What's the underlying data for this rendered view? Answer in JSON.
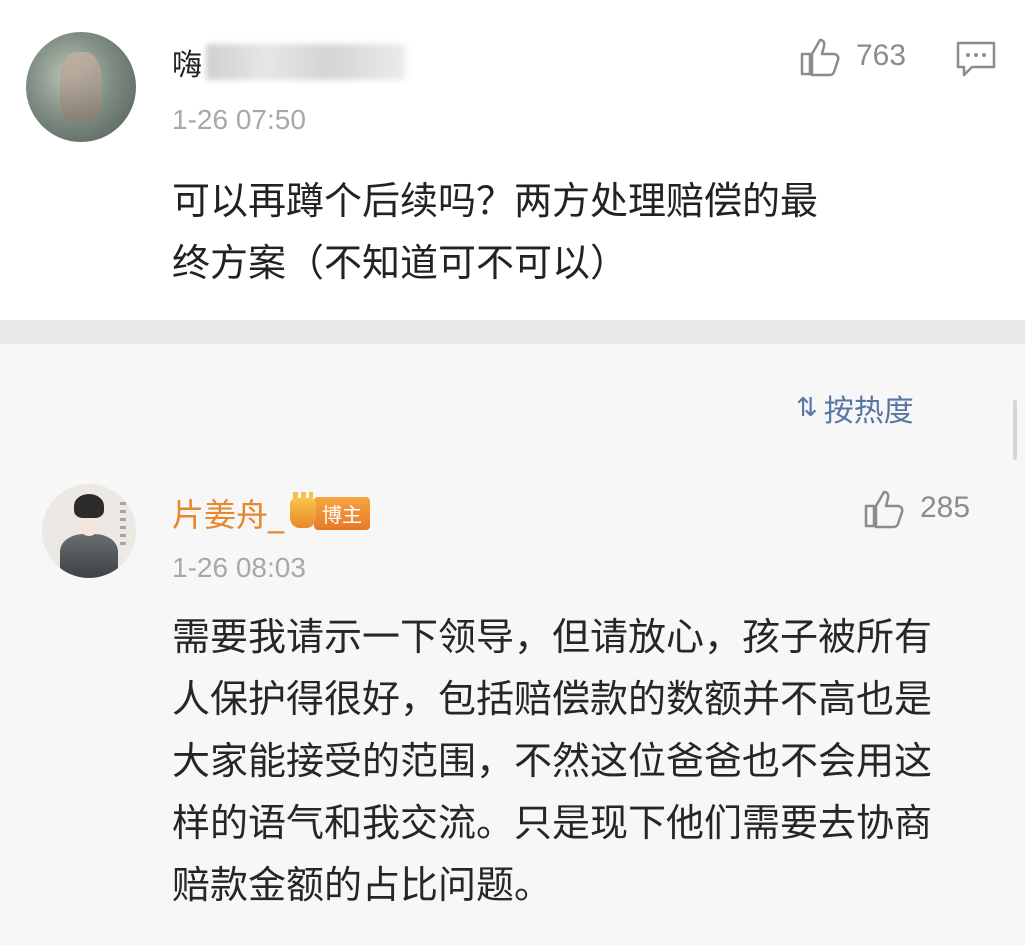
{
  "comment": {
    "username_visible": "嗨",
    "timestamp": "1-26 07:50",
    "likes": "763",
    "text_line1": "可以再蹲个后续吗？两方处理赔偿的最",
    "text_line2": "终方案（不知道可不可以）"
  },
  "sort": {
    "label": "按热度",
    "icon": "sort-icon"
  },
  "reply": {
    "username": "片姜舟_",
    "badge": "博主",
    "timestamp": "1-26 08:03",
    "likes": "285",
    "lines": [
      "需要我请示一下领导，但请放心，孩子被所有",
      "人保护得很好，包括赔偿款的数额并不高也是",
      "大家能接受的范围，不然这位爸爸也不会用这",
      "样的语气和我交流。只是现下他们需要去协商",
      "赔款金额的占比问题。"
    ]
  },
  "colors": {
    "accent_name": "#e8862b",
    "link_blue": "#5677a4",
    "muted": "#a8a8a8"
  }
}
